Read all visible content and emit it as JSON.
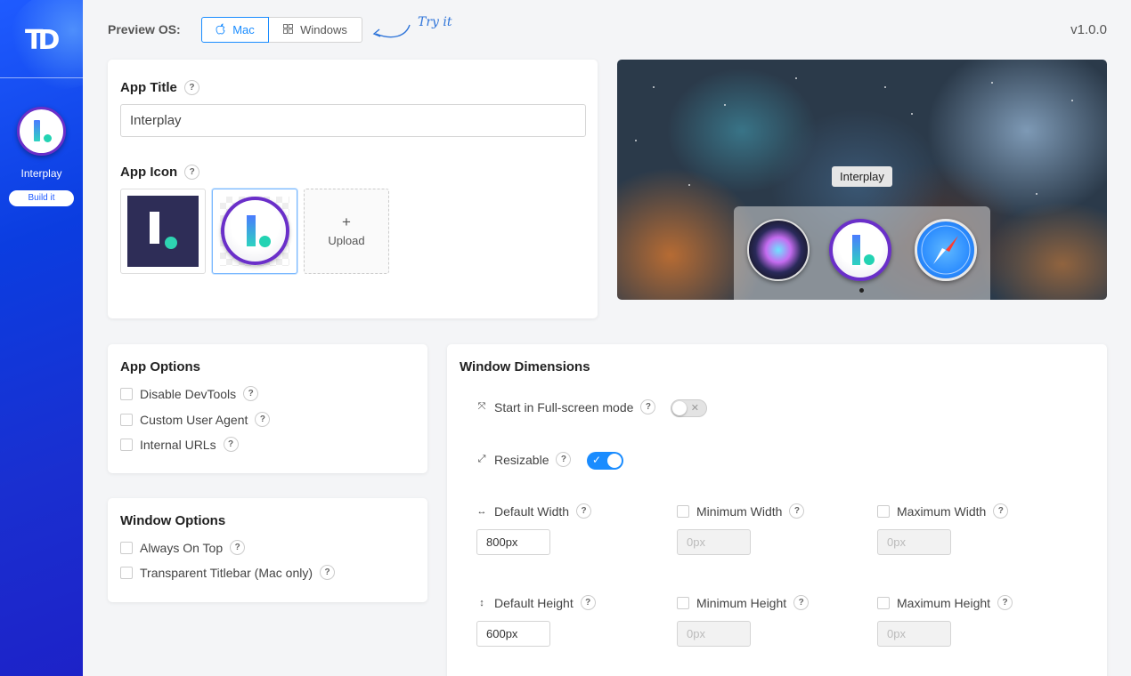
{
  "sidebar": {
    "logo": "TD",
    "app_name": "Interplay",
    "build_label": "Build it"
  },
  "topbar": {
    "preview_label": "Preview OS:",
    "os_options": [
      "Mac",
      "Windows"
    ],
    "selected_os": "Mac",
    "try_it": "Try it",
    "version": "v1.0.0"
  },
  "app_card": {
    "title_label": "App Title",
    "title_value": "Interplay",
    "icon_label": "App Icon",
    "upload_plus": "+",
    "upload_label": "Upload"
  },
  "preview": {
    "tooltip": "Interplay"
  },
  "app_options": {
    "title": "App Options",
    "items": [
      "Disable DevTools",
      "Custom User Agent",
      "Internal URLs"
    ]
  },
  "window_options": {
    "title": "Window Options",
    "items": [
      "Always On Top",
      "Transparent Titlebar (Mac only)"
    ]
  },
  "window_dimensions": {
    "title": "Window Dimensions",
    "fullscreen_label": "Start in Full-screen mode",
    "fullscreen_on": false,
    "resizable_label": "Resizable",
    "resizable_on": true,
    "default_width_label": "Default Width",
    "default_width_value": "800px",
    "min_width_label": "Minimum Width",
    "min_width_placeholder": "0px",
    "max_width_label": "Maximum Width",
    "max_width_placeholder": "0px",
    "default_height_label": "Default Height",
    "default_height_value": "600px",
    "min_height_label": "Minimum Height",
    "min_height_placeholder": "0px",
    "max_height_label": "Maximum Height",
    "max_height_placeholder": "0px"
  },
  "help_mark": "?",
  "colors": {
    "accent": "#1a8cff",
    "sidebar": "#0b3de0",
    "icon_ring": "#6a2fc9",
    "icon_dot": "#23d3b3"
  }
}
